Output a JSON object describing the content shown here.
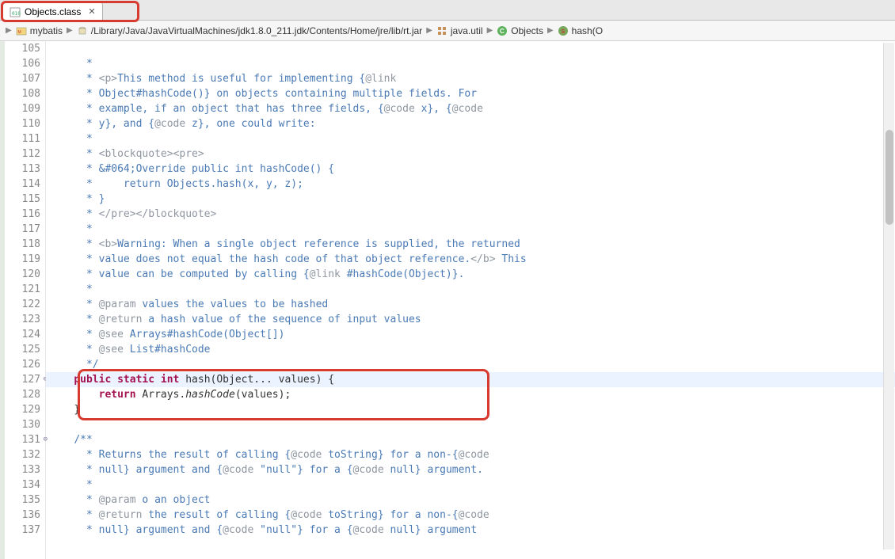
{
  "tab": {
    "label": "Objects.class"
  },
  "breadcrumb": {
    "items": [
      {
        "label": "mybatis",
        "icon": "project"
      },
      {
        "label": "/Library/Java/JavaVirtualMachines/jdk1.8.0_211.jdk/Contents/Home/jre/lib/rt.jar",
        "icon": "jar"
      },
      {
        "label": "java.util",
        "icon": "package"
      },
      {
        "label": "Objects",
        "icon": "class"
      },
      {
        "label": "hash(O",
        "icon": "method"
      }
    ]
  },
  "lines": {
    "105": {
      "t": "",
      "pre": "    "
    },
    "106": {
      "t": " *",
      "cls": "tok-comment",
      "pre": "     "
    },
    "107": {
      "pre": "     ",
      "segs": [
        {
          "t": " * ",
          "c": "tok-comment"
        },
        {
          "t": "<p>",
          "c": "tok-tag"
        },
        {
          "t": "This method is useful for implementing {",
          "c": "tok-comment"
        },
        {
          "t": "@link",
          "c": "tok-doctag"
        }
      ]
    },
    "108": {
      "t": " * Object#hashCode()} on objects containing multiple fields. For",
      "cls": "tok-comment",
      "pre": "     "
    },
    "109": {
      "pre": "     ",
      "segs": [
        {
          "t": " * example, if an object that has three fields, {",
          "c": "tok-comment"
        },
        {
          "t": "@code",
          "c": "tok-doctag"
        },
        {
          "t": " x}, {",
          "c": "tok-comment"
        },
        {
          "t": "@code",
          "c": "tok-doctag"
        }
      ]
    },
    "110": {
      "pre": "     ",
      "segs": [
        {
          "t": " * y}, and {",
          "c": "tok-comment"
        },
        {
          "t": "@code",
          "c": "tok-doctag"
        },
        {
          "t": " z}, one could write:",
          "c": "tok-comment"
        }
      ]
    },
    "111": {
      "t": " *",
      "cls": "tok-comment",
      "pre": "     "
    },
    "112": {
      "pre": "     ",
      "segs": [
        {
          "t": " * ",
          "c": "tok-comment"
        },
        {
          "t": "<blockquote><pre>",
          "c": "tok-tag"
        }
      ]
    },
    "113": {
      "t": " * &#064;Override public int hashCode() {",
      "cls": "tok-comment",
      "pre": "     "
    },
    "114": {
      "t": " *     return Objects.hash(x, y, z);",
      "cls": "tok-comment",
      "pre": "     "
    },
    "115": {
      "t": " * }",
      "cls": "tok-comment",
      "pre": "     "
    },
    "116": {
      "pre": "     ",
      "segs": [
        {
          "t": " * ",
          "c": "tok-comment"
        },
        {
          "t": "</pre></blockquote>",
          "c": "tok-tag"
        }
      ]
    },
    "117": {
      "t": " *",
      "cls": "tok-comment",
      "pre": "     "
    },
    "118": {
      "pre": "     ",
      "segs": [
        {
          "t": " * ",
          "c": "tok-comment"
        },
        {
          "t": "<b>",
          "c": "tok-tag"
        },
        {
          "t": "Warning: When a single object reference is supplied, the returned",
          "c": "tok-comment"
        }
      ]
    },
    "119": {
      "pre": "     ",
      "segs": [
        {
          "t": " * value does not equal the hash code of that object reference.",
          "c": "tok-comment"
        },
        {
          "t": "</b>",
          "c": "tok-tag"
        },
        {
          "t": " This",
          "c": "tok-comment"
        }
      ]
    },
    "120": {
      "pre": "     ",
      "segs": [
        {
          "t": " * value can be computed by calling {",
          "c": "tok-comment"
        },
        {
          "t": "@link",
          "c": "tok-doctag"
        },
        {
          "t": " #hashCode(Object)}.",
          "c": "tok-comment"
        }
      ]
    },
    "121": {
      "t": " *",
      "cls": "tok-comment",
      "pre": "     "
    },
    "122": {
      "pre": "     ",
      "segs": [
        {
          "t": " * ",
          "c": "tok-comment"
        },
        {
          "t": "@param",
          "c": "tok-doctag"
        },
        {
          "t": " values the values to be hashed",
          "c": "tok-comment"
        }
      ]
    },
    "123": {
      "pre": "     ",
      "segs": [
        {
          "t": " * ",
          "c": "tok-comment"
        },
        {
          "t": "@return",
          "c": "tok-doctag"
        },
        {
          "t": " a hash value of the sequence of input values",
          "c": "tok-comment"
        }
      ]
    },
    "124": {
      "pre": "     ",
      "segs": [
        {
          "t": " * ",
          "c": "tok-comment"
        },
        {
          "t": "@see",
          "c": "tok-doctag"
        },
        {
          "t": " Arrays#hashCode(Object[])",
          "c": "tok-comment"
        }
      ]
    },
    "125": {
      "pre": "     ",
      "segs": [
        {
          "t": " * ",
          "c": "tok-comment"
        },
        {
          "t": "@see",
          "c": "tok-doctag"
        },
        {
          "t": " List#hashCode",
          "c": "tok-comment"
        }
      ]
    },
    "126": {
      "t": " */",
      "cls": "tok-comment",
      "pre": "     "
    },
    "127": {
      "hl": true,
      "fold": "⊖",
      "pre": "    ",
      "segs": [
        {
          "t": "public",
          "c": "tok-keyword"
        },
        {
          "t": " ",
          "c": "tok-plain"
        },
        {
          "t": "static",
          "c": "tok-keyword"
        },
        {
          "t": " ",
          "c": "tok-plain"
        },
        {
          "t": "int",
          "c": "tok-keyword"
        },
        {
          "t": " hash(Object... values) {",
          "c": "tok-plain"
        }
      ]
    },
    "128": {
      "pre": "        ",
      "segs": [
        {
          "t": "return",
          "c": "tok-keyword"
        },
        {
          "t": " Arrays.",
          "c": "tok-plain"
        },
        {
          "t": "hashCode",
          "c": "tok-method"
        },
        {
          "t": "(values);",
          "c": "tok-plain"
        }
      ]
    },
    "129": {
      "t": "}",
      "cls": "tok-plain",
      "pre": "    "
    },
    "130": {
      "t": "",
      "pre": ""
    },
    "131": {
      "fold": "⊖",
      "t": "/**",
      "cls": "tok-comment",
      "pre": "    "
    },
    "132": {
      "pre": "     ",
      "segs": [
        {
          "t": " * Returns the result of calling {",
          "c": "tok-comment"
        },
        {
          "t": "@code",
          "c": "tok-doctag"
        },
        {
          "t": " toString} for a non-{",
          "c": "tok-comment"
        },
        {
          "t": "@code",
          "c": "tok-doctag"
        }
      ]
    },
    "133": {
      "pre": "     ",
      "segs": [
        {
          "t": " * null} argument and {",
          "c": "tok-comment"
        },
        {
          "t": "@code",
          "c": "tok-doctag"
        },
        {
          "t": " \"null\"} for a {",
          "c": "tok-comment"
        },
        {
          "t": "@code",
          "c": "tok-doctag"
        },
        {
          "t": " null} argument.",
          "c": "tok-comment"
        }
      ]
    },
    "134": {
      "t": " *",
      "cls": "tok-comment",
      "pre": "     "
    },
    "135": {
      "pre": "     ",
      "segs": [
        {
          "t": " * ",
          "c": "tok-comment"
        },
        {
          "t": "@param",
          "c": "tok-doctag"
        },
        {
          "t": " o an object",
          "c": "tok-comment"
        }
      ]
    },
    "136": {
      "pre": "     ",
      "segs": [
        {
          "t": " * ",
          "c": "tok-comment"
        },
        {
          "t": "@return",
          "c": "tok-doctag"
        },
        {
          "t": " the result of calling {",
          "c": "tok-comment"
        },
        {
          "t": "@code",
          "c": "tok-doctag"
        },
        {
          "t": " toString} for a non-{",
          "c": "tok-comment"
        },
        {
          "t": "@code",
          "c": "tok-doctag"
        }
      ]
    },
    "137": {
      "pre": "     ",
      "segs": [
        {
          "t": " * null} argument and {",
          "c": "tok-comment"
        },
        {
          "t": "@code",
          "c": "tok-doctag"
        },
        {
          "t": " \"null\"} for a {",
          "c": "tok-comment"
        },
        {
          "t": "@code",
          "c": "tok-doctag"
        },
        {
          "t": " null} argument",
          "c": "tok-comment"
        }
      ]
    }
  },
  "lineStart": 105,
  "lineEnd": 137,
  "highlightBox": {
    "topLine": 127,
    "heightLines": 3
  }
}
